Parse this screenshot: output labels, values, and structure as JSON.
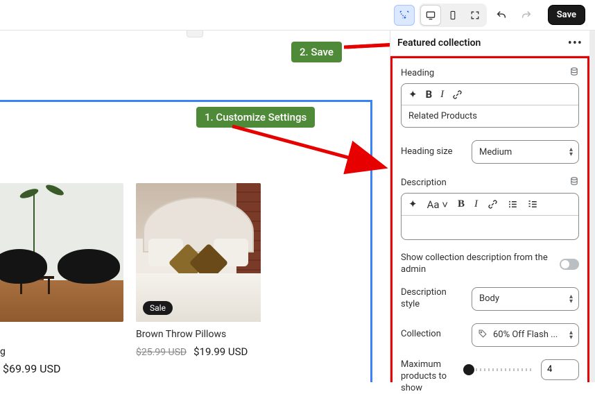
{
  "topbar": {
    "save_label": "Save"
  },
  "panel": {
    "title": "Featured collection",
    "heading_label": "Heading",
    "heading_value": "Related Products",
    "heading_size_label": "Heading size",
    "heading_size_value": "Medium",
    "description_label": "Description",
    "description_value": "",
    "show_desc_label": "Show collection description from the admin",
    "desc_style_label": "Description style",
    "desc_style_value": "Body",
    "collection_label": "Collection",
    "collection_value": "60% Off Flash ...",
    "max_products_label": "Maximum products to show",
    "max_products_value": "4"
  },
  "callouts": {
    "step1": "1. Customize Settings",
    "step2": "2. Save"
  },
  "preview": {
    "left_frag": "g",
    "left_price": "$69.99 USD",
    "card2": {
      "sale_badge": "Sale",
      "name": "Brown Throw Pillows",
      "orig": "$25.99 USD",
      "sale": "$19.99 USD"
    }
  }
}
